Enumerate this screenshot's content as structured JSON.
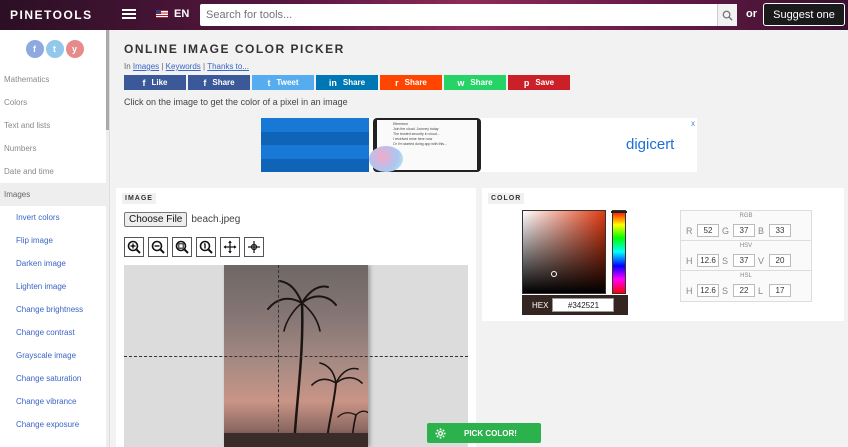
{
  "header": {
    "logo": "PINETOOLS",
    "language": "EN",
    "search_placeholder": "Search for tools...",
    "or": "or",
    "suggest_label": "Suggest one"
  },
  "sidebar": {
    "social": [
      "f",
      "t",
      "y"
    ],
    "categories": [
      "Mathematics",
      "Colors",
      "Text and lists",
      "Numbers",
      "Date and time",
      "Images"
    ],
    "active_category": "Images",
    "sub_items": [
      "Invert colors",
      "Flip image",
      "Darken image",
      "Lighten image",
      "Change brightness",
      "Change contrast",
      "Grayscale image",
      "Change saturation",
      "Change vibrance",
      "Change exposure"
    ]
  },
  "page": {
    "title": "ONLINE IMAGE COLOR PICKER",
    "breadcrumb_prefix": "In",
    "breadcrumb_links": [
      "Images",
      "Keywords",
      "Thanks to..."
    ],
    "instruction": "Click on the image to get the color of a pixel in an image"
  },
  "shares": [
    {
      "icon": "f",
      "label": "Like",
      "color": "#3b5998"
    },
    {
      "icon": "f",
      "label": "Share",
      "color": "#3b5998"
    },
    {
      "icon": "t",
      "label": "Tweet",
      "color": "#55acee"
    },
    {
      "icon": "in",
      "label": "Share",
      "color": "#0077b5"
    },
    {
      "icon": "r",
      "label": "Share",
      "color": "#ff4500"
    },
    {
      "icon": "w",
      "label": "Share",
      "color": "#25d366"
    },
    {
      "icon": "p",
      "label": "Save",
      "color": "#cb2027"
    }
  ],
  "ad": {
    "brand": "digicert",
    "close": "x",
    "lines": [
      "Ethereum",
      "Join the cloud. Journey today",
      "The trusted security in cloud...",
      "",
      "I received mine here now",
      "Or I'm started doing app with this..."
    ]
  },
  "image_panel": {
    "label": "IMAGE",
    "choose_file": "Choose File",
    "file_name": "beach.jpeg"
  },
  "color_panel": {
    "label": "COLOR",
    "hex_label": "HEX",
    "hex_value": "#342521",
    "selected_color": "#342521",
    "groups": [
      {
        "title": "RGB",
        "channels": [
          {
            "k": "R",
            "v": "52"
          },
          {
            "k": "G",
            "v": "37"
          },
          {
            "k": "B",
            "v": "33"
          }
        ]
      },
      {
        "title": "HSV",
        "channels": [
          {
            "k": "H",
            "v": "12.6"
          },
          {
            "k": "S",
            "v": "37"
          },
          {
            "k": "V",
            "v": "20"
          }
        ]
      },
      {
        "title": "HSL",
        "channels": [
          {
            "k": "H",
            "v": "12.6"
          },
          {
            "k": "S",
            "v": "22"
          },
          {
            "k": "L",
            "v": "17"
          }
        ]
      }
    ]
  },
  "pick_button": "PICK COLOR!"
}
